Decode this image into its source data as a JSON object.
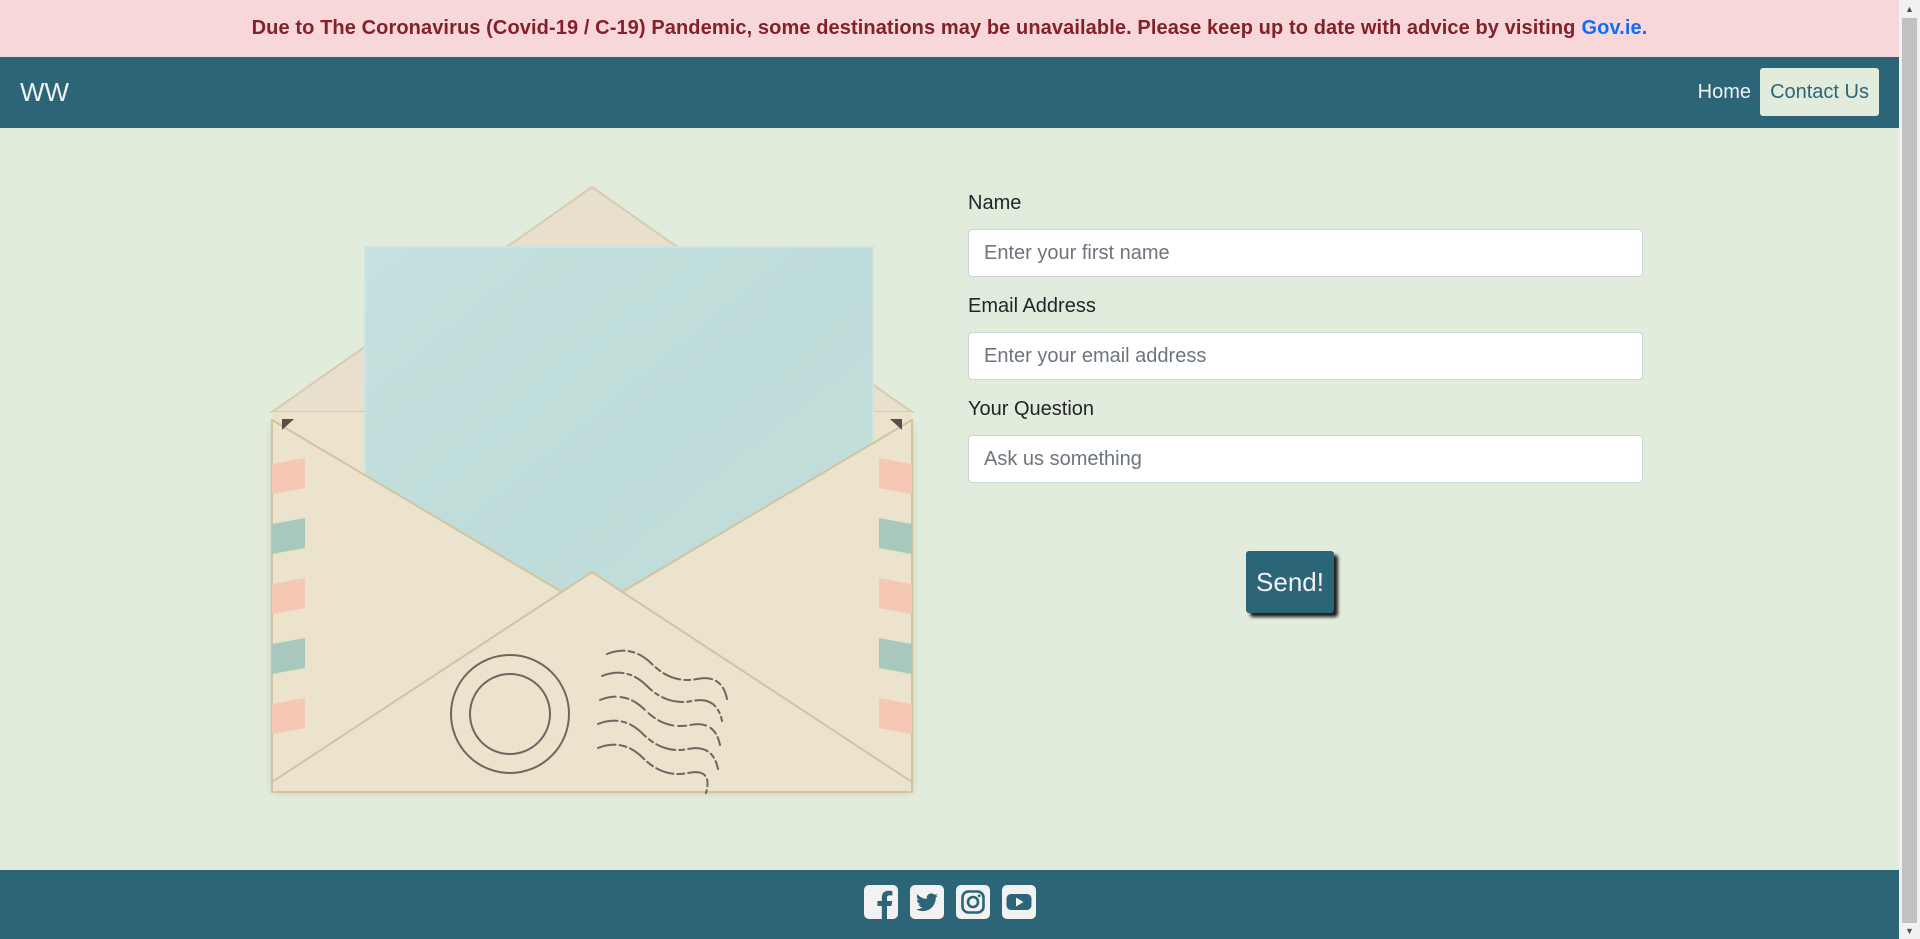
{
  "alert": {
    "message": "Due to The Coronavirus (Covid-19 / C-19) Pandemic, some destinations may be unavailable. Please keep up to date with advice by visiting",
    "link_text": "Gov.ie."
  },
  "navbar": {
    "brand": "WW",
    "items": [
      {
        "label": "Home",
        "active": false
      },
      {
        "label": "Contact Us",
        "active": true
      }
    ]
  },
  "form": {
    "name": {
      "label": "Name",
      "placeholder": "Enter your first name",
      "value": ""
    },
    "email": {
      "label": "Email Address",
      "placeholder": "Enter your email address",
      "value": ""
    },
    "question": {
      "label": "Your Question",
      "placeholder": "Ask us something",
      "value": ""
    },
    "submit_label": "Send!"
  },
  "footer": {
    "socials": [
      "facebook-icon",
      "twitter-icon",
      "instagram-icon",
      "youtube-icon"
    ]
  },
  "colors": {
    "primary": "#2c6577",
    "background": "#e2ecdc",
    "alert_bg": "#f8d7da",
    "alert_text": "#842029",
    "link": "#0d6efd"
  }
}
